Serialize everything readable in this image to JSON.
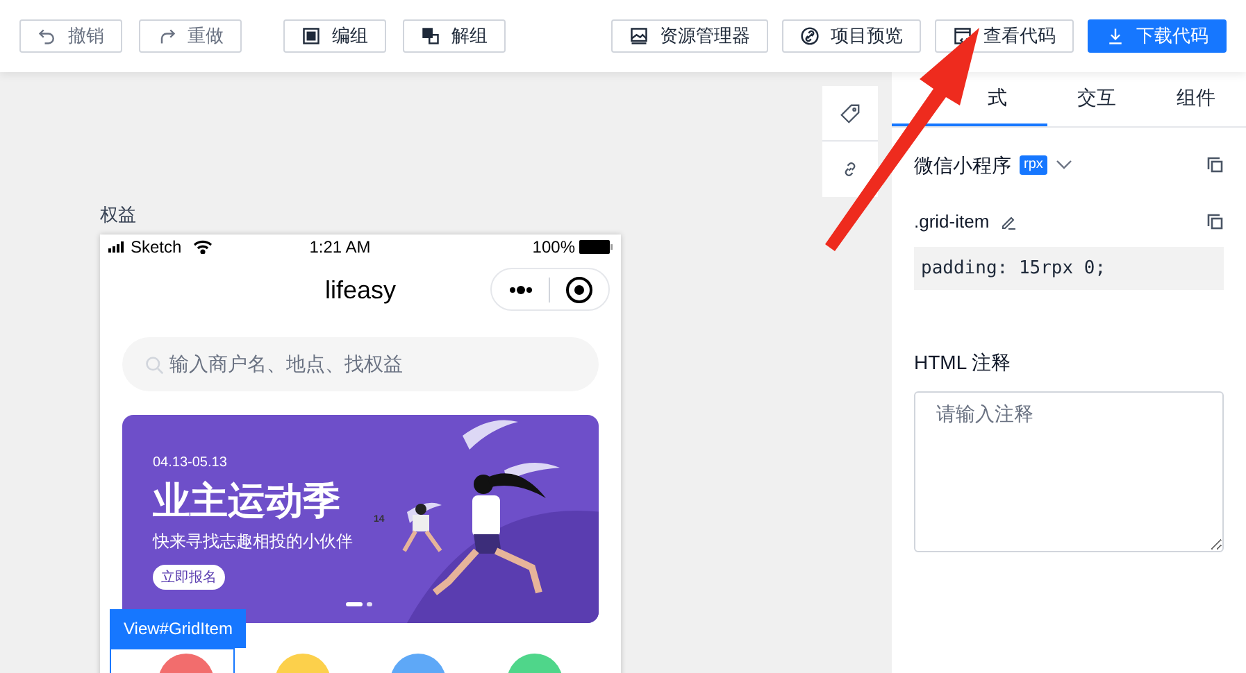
{
  "toolbar": {
    "left": [
      {
        "label": "撤销",
        "disabled": true
      },
      {
        "label": "重做",
        "disabled": true
      }
    ],
    "middle": [
      {
        "label": "编组",
        "disabled": false
      },
      {
        "label": "解组",
        "disabled": false
      }
    ],
    "right": [
      {
        "label": "资源管理器",
        "kind": "default"
      },
      {
        "label": "项目预览",
        "kind": "default"
      },
      {
        "label": "查看代码",
        "kind": "default"
      },
      {
        "label": "下载代码",
        "kind": "primary"
      }
    ]
  },
  "canvas": {
    "page_label": "权益",
    "phone": {
      "carrier": "Sketch",
      "time": "1:21 AM",
      "battery": "100%",
      "title": "lifeasy",
      "search": {
        "placeholder": "输入商户名、地点、找权益"
      },
      "banner": {
        "date": "04.13-05.13",
        "headline": "业主运动季",
        "subtitle": "快来寻找志趣相投的小伙伴",
        "button": "立即报名",
        "jersey": "14",
        "dots": [
          {
            "selected": true
          },
          {
            "selected": false
          }
        ]
      },
      "grid_items": [
        {
          "color": "#f26d6d"
        },
        {
          "color": "#fcd04b"
        },
        {
          "color": "#5ea8f7"
        },
        {
          "color": "#4fd68a"
        }
      ]
    },
    "selection_label": "View#GridItem"
  },
  "panel": {
    "tabs": [
      {
        "label": "式",
        "selected": true
      },
      {
        "label": "交互",
        "selected": false
      },
      {
        "label": "组件",
        "selected": false
      }
    ],
    "platform": "微信小程序",
    "unit_badge": "rpx",
    "selector": ".grid-item",
    "code": "padding: 15rpx 0;",
    "comment_label": "HTML 注释",
    "comment": {
      "placeholder": "请输入注释"
    }
  }
}
